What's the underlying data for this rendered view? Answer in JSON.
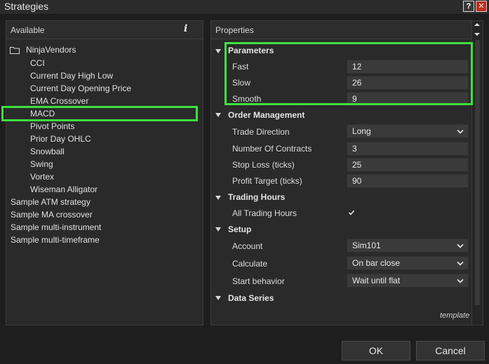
{
  "window": {
    "title": "Strategies",
    "help_label": "?",
    "close_label": "✕"
  },
  "available": {
    "header": "Available",
    "info_label": "i",
    "folder": "NinjaVendors",
    "items": [
      "CCI",
      "Current Day High Low",
      "Current Day Opening Price",
      "EMA Crossover",
      "MACD",
      "Pivot Points",
      "Prior Day OHLC",
      "Snowball",
      "Swing",
      "Vortex",
      "Wiseman Alligator"
    ],
    "root_items": [
      "Sample ATM strategy",
      "Sample MA crossover",
      "Sample multi-instrument",
      "Sample multi-timeframe"
    ],
    "selected": "MACD"
  },
  "properties": {
    "header": "Properties",
    "parameters": {
      "label": "Parameters",
      "fast_label": "Fast",
      "fast": "12",
      "slow_label": "Slow",
      "slow": "26",
      "smooth_label": "Smooth",
      "smooth": "9"
    },
    "order_management": {
      "label": "Order Management",
      "trade_direction_label": "Trade Direction",
      "trade_direction": "Long",
      "contracts_label": "Number Of Contracts",
      "contracts": "3",
      "stop_loss_label": "Stop Loss (ticks)",
      "stop_loss": "25",
      "profit_target_label": "Profit Target (ticks)",
      "profit_target": "90"
    },
    "trading_hours": {
      "label": "Trading Hours",
      "all_label": "All Trading Hours",
      "all_checked": true
    },
    "setup": {
      "label": "Setup",
      "account_label": "Account",
      "account": "Sim101",
      "calculate_label": "Calculate",
      "calculate": "On bar close",
      "start_behavior_label": "Start behavior",
      "start_behavior": "Wait until flat"
    },
    "data_series": {
      "label": "Data Series"
    },
    "template_label": "template"
  },
  "buttons": {
    "ok": "OK",
    "cancel": "Cancel"
  },
  "colors": {
    "highlight": "#3ee03e",
    "background": "#1e1e1e",
    "panel": "#2a2a2a",
    "field": "#3a3a3a"
  }
}
